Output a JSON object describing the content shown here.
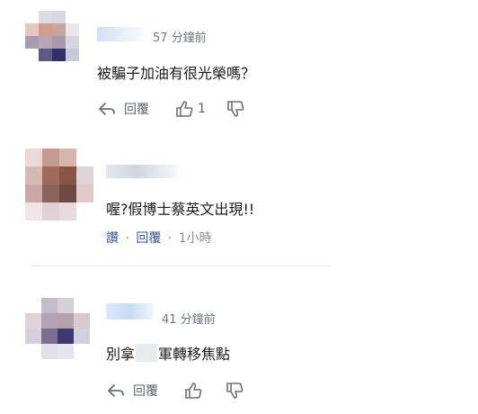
{
  "comments": [
    {
      "time": "57 分鐘前",
      "text": "被騙子加油有很光榮嗎？",
      "reply_label": "回覆",
      "like_count": "1"
    },
    {
      "text": "喔?假博士蔡英文出現!!",
      "like_label": "讚",
      "reply_label": "回覆",
      "time": "1小時",
      "separator": "·"
    },
    {
      "time": "41 分鐘前",
      "text_part1": "別拿",
      "text_part2": "軍轉移焦點",
      "reply_label": "回覆"
    }
  ],
  "colors": {
    "link": "#385898",
    "muted": "#6f7680",
    "divider": "#e4e6eb"
  },
  "icons": [
    "reply-icon",
    "thumbs-up-icon",
    "thumbs-down-icon"
  ]
}
